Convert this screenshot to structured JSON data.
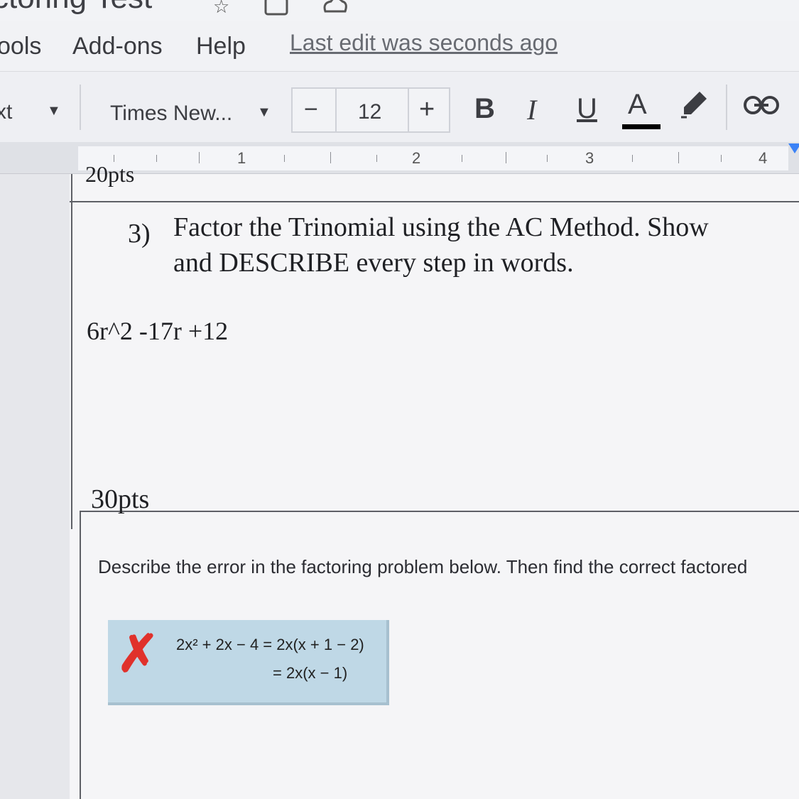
{
  "window": {
    "doc_title": "ctoring Test",
    "title_icons": [
      "star-icon",
      "folder-move-icon",
      "cloud-status-icon"
    ]
  },
  "menubar": {
    "items": [
      "ools",
      "Add-ons",
      "Help"
    ],
    "last_edit": "Last edit was seconds ago"
  },
  "toolbar": {
    "style_partial": "xt",
    "font_name": "Times New...",
    "decrease_label": "−",
    "font_size": "12",
    "increase_label": "+",
    "bold_label": "B",
    "italic_label": "I",
    "underline_label": "U",
    "text_color_label": "A",
    "text_color_value": "#000000"
  },
  "ruler": {
    "numbers": [
      "1",
      "2",
      "3",
      "4"
    ]
  },
  "document": {
    "previous_points_partial": "20pts",
    "question_number": "3)",
    "question_line1": "Factor the Trinomial using the AC Method. Show",
    "question_line2": "and DESCRIBE every step in words.",
    "expression": "6r^2 -17r +12",
    "points": "30pts",
    "describe_prompt": "Describe the error in the factoring problem below. Then find the correct factored",
    "error_example": {
      "mark": "✗",
      "line1": "2x² + 2x − 4 = 2x(x + 1 − 2)",
      "line2": "= 2x(x − 1)"
    }
  },
  "colors": {
    "accent": "#3b82f6",
    "error_red": "#e0312b",
    "example_box": "#bfd8e6"
  }
}
